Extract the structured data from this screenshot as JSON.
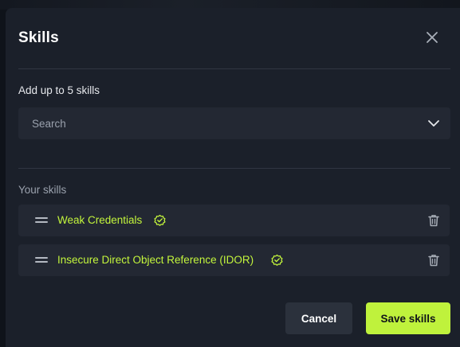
{
  "dialog": {
    "title": "Skills",
    "hint": "Add up to 5 skills",
    "search": {
      "placeholder": "Search",
      "value": ""
    },
    "section_label": "Your skills",
    "skills": [
      {
        "name": "Weak Credentials",
        "verified": true
      },
      {
        "name": "Insecure Direct Object Reference (IDOR)",
        "verified": true
      }
    ],
    "cancel_label": "Cancel",
    "save_label": "Save skills"
  },
  "colors": {
    "accent": "#c3f53c",
    "surface": "#1b202a",
    "field": "#232833"
  },
  "icons": [
    "close-icon",
    "chevron-down-icon",
    "drag-handle-icon",
    "verified-badge-icon",
    "trash-icon"
  ]
}
